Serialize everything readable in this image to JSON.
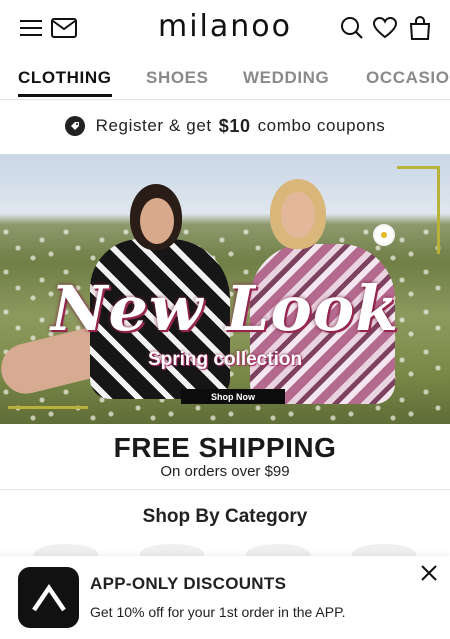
{
  "header": {
    "logo_text": "milanoo",
    "menu_icon": "hamburger-menu-icon",
    "mail_icon": "mail-icon",
    "search_icon": "search-icon",
    "wishlist_icon": "heart-icon",
    "cart_icon": "shopping-bag-icon"
  },
  "tabs": [
    {
      "label": "CLOTHING",
      "active": true
    },
    {
      "label": "SHOES",
      "active": false
    },
    {
      "label": "WEDDING",
      "active": false
    },
    {
      "label": "OCCASION",
      "active": false
    }
  ],
  "register": {
    "prefix": "Register & get",
    "amount": "$10",
    "suffix": "combo coupons",
    "icon": "coupon-ticket-icon"
  },
  "banner": {
    "title": "New Look",
    "subtitle": "Spring collection",
    "cta": "Shop Now"
  },
  "shipping": {
    "title": "FREE SHIPPING",
    "subtitle": "On orders over $99"
  },
  "category": {
    "heading": "Shop By Category"
  },
  "app_promo": {
    "title": "APP-ONLY DISCOUNTS",
    "subtitle": "Get 10% off for your 1st order in the APP.",
    "logo_icon": "app-logo-icon",
    "close_icon": "close-icon"
  },
  "colors": {
    "text_dark": "#111111",
    "tab_inactive": "#8a8a8a",
    "accent_gold": "#b8b23a",
    "banner_pink": "#a02a55"
  }
}
